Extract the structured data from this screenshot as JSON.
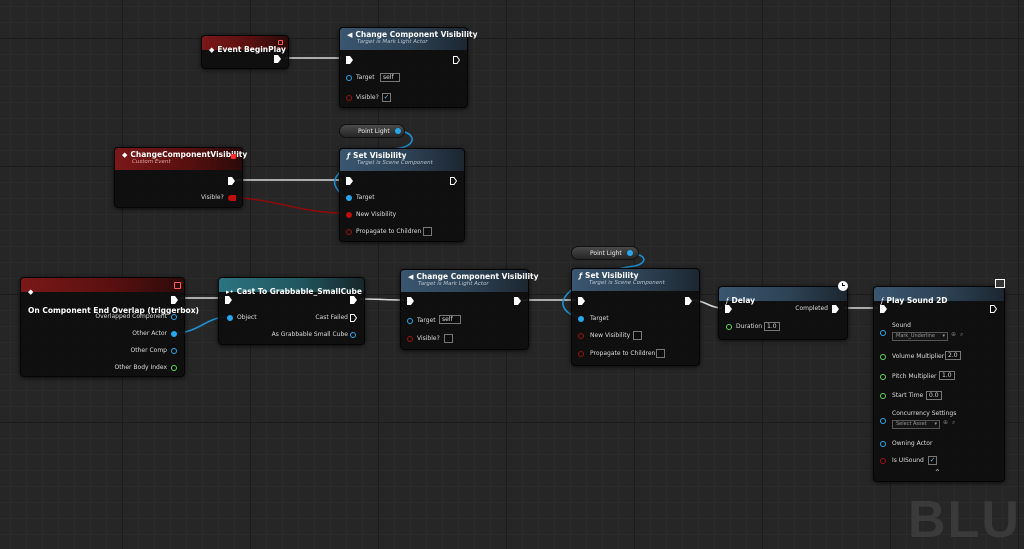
{
  "nodes": {
    "begin_play": {
      "title": "Event BeginPlay"
    },
    "change_vis_top": {
      "title": "Change Component Visibility",
      "subtitle": "Target is Mark Light Actor",
      "target_label": "Target",
      "target_value": "self",
      "visible_label": "Visible?",
      "visible_checked": "✓"
    },
    "point_light_1": {
      "label": "Point Light"
    },
    "custom_event": {
      "title": "ChangeComponentVisibility",
      "subtitle": "Custom Event",
      "visible_label": "Visible?"
    },
    "set_vis_1": {
      "title": "Set Visibility",
      "subtitle": "Target is Scene Component",
      "target_label": "Target",
      "new_vis_label": "New Visibility",
      "propagate_label": "Propagate to Children"
    },
    "end_overlap": {
      "title": "On Component End Overlap (triggerbox)",
      "overlapped": "Overlapped Component",
      "other_actor": "Other Actor",
      "other_comp": "Other Comp",
      "body_index": "Other Body Index"
    },
    "cast": {
      "title": "Cast To Grabbable_SmallCube",
      "object_label": "Object",
      "cast_failed": "Cast Failed",
      "as_label": "As Grabbable Small Cube"
    },
    "change_vis_mid": {
      "title": "Change Component Visibility",
      "subtitle": "Target is Mark Light Actor",
      "target_label": "Target",
      "target_value": "self",
      "visible_label": "Visible?"
    },
    "point_light_2": {
      "label": "Point Light"
    },
    "set_vis_2": {
      "title": "Set Visibility",
      "subtitle": "Target is Scene Component",
      "target_label": "Target",
      "new_vis_label": "New Visibility",
      "propagate_label": "Propagate to Children"
    },
    "delay": {
      "title": "Delay",
      "completed_label": "Completed",
      "duration_label": "Duration",
      "duration_value": "1.0"
    },
    "play_sound": {
      "title": "Play Sound 2D",
      "sound_label": "Sound",
      "sound_value": "Mark_Underline",
      "volume_label": "Volume Multiplier",
      "volume_value": "2.0",
      "pitch_label": "Pitch Multiplier",
      "pitch_value": "1.0",
      "start_label": "Start Time",
      "start_value": "0.0",
      "concurrency_label": "Concurrency Settings",
      "concurrency_value": "Select Asset",
      "owning_label": "Owning Actor",
      "is_ui_label": "Is UISound",
      "is_ui_checked": "✓"
    }
  },
  "watermark": "BLU",
  "colors": {
    "exec": "#ffffff",
    "object_pin": "#29a7ec",
    "bool_pin": "#9e1212",
    "float_pin": "#5fd654"
  }
}
